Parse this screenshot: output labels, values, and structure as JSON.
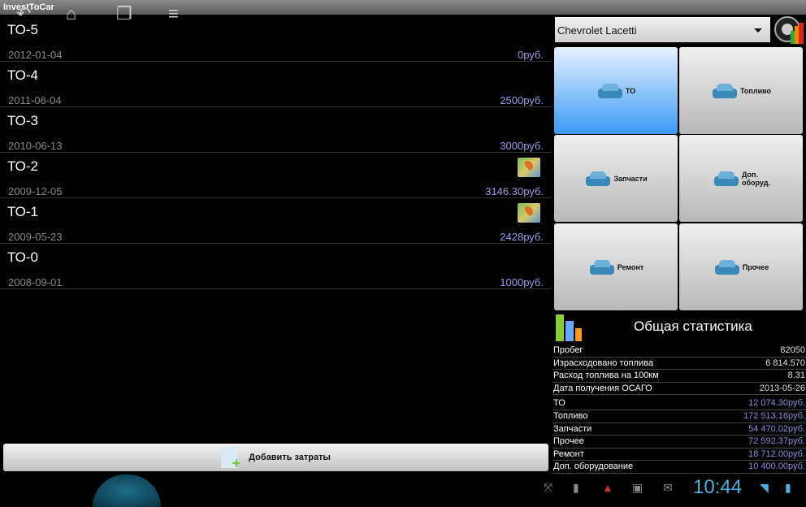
{
  "app": {
    "title": "InvestToCar"
  },
  "entries": [
    {
      "title": "ТО-5",
      "date": "2012-01-04",
      "amount": "0руб.",
      "map": false
    },
    {
      "title": "ТО-4",
      "date": "2011-06-04",
      "amount": "2500руб.",
      "map": false
    },
    {
      "title": "ТО-3",
      "date": "2010-06-13",
      "amount": "3000руб.",
      "map": false
    },
    {
      "title": "ТО-2",
      "date": "2009-12-05",
      "amount": "3146.30руб.",
      "map": true
    },
    {
      "title": "ТО-1",
      "date": "2009-05-23",
      "amount": "2428руб.",
      "map": true
    },
    {
      "title": "ТО-0",
      "date": "2008-09-01",
      "amount": "1000руб.",
      "map": false
    }
  ],
  "car_select": {
    "value": "Chevrolet Lacetti"
  },
  "categories": [
    {
      "label": "ТО",
      "active": true
    },
    {
      "label": "Топливо"
    },
    {
      "label": "Запчасти"
    },
    {
      "label": "Доп. оборуд."
    },
    {
      "label": "Ремонт"
    },
    {
      "label": "Прочее"
    }
  ],
  "stats": {
    "title": "Общая статистика",
    "general": [
      {
        "label": "Пробег",
        "value": "82050"
      },
      {
        "label": "Израсходовано топлива",
        "value": "6 814.570"
      },
      {
        "label": "Расход топлива на 100км",
        "value": "8.31"
      },
      {
        "label": "Дата получения ОСАГО",
        "value": "2013-05-26"
      }
    ],
    "money": [
      {
        "label": "ТО",
        "value": "12 074.30руб."
      },
      {
        "label": "Топливо",
        "value": "172 513.16руб."
      },
      {
        "label": "Запчасти",
        "value": "54 470.02руб."
      },
      {
        "label": "Прочее",
        "value": "72 592.37руб."
      },
      {
        "label": "Ремонт",
        "value": "18 712.00руб."
      },
      {
        "label": "Доп. оборудование",
        "value": "10 400.00руб."
      }
    ]
  },
  "add_button": {
    "label": "Добавить затраты"
  },
  "status": {
    "time": "10:44"
  },
  "colors": {
    "accent": "#3a9af5",
    "amount": "#9a9ae8",
    "clock": "#4ab0e0"
  }
}
